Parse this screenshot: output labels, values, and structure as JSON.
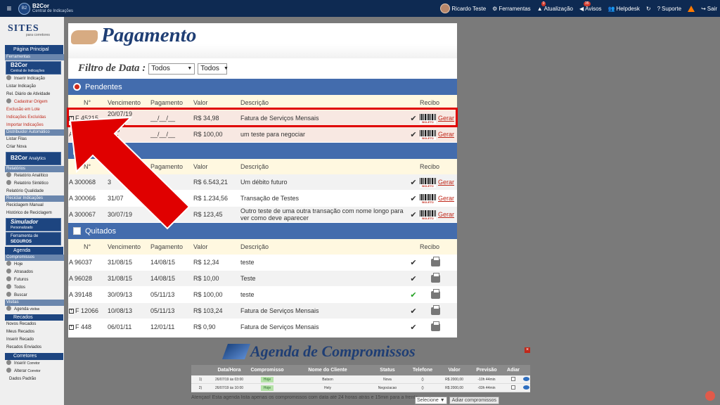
{
  "topbar": {
    "logo_title": "B2Cor",
    "logo_subtitle": "Central de Indicações",
    "user": "Ricardo Teste",
    "items": [
      {
        "label": "Ferramentas"
      },
      {
        "label": "Atualização",
        "badge": "0"
      },
      {
        "label": "Avisos",
        "badge": "35"
      },
      {
        "label": "Helpdesk"
      },
      {
        "label": "Suporte"
      },
      {
        "label": "Sair"
      }
    ]
  },
  "sidebar": {
    "logo": "SITES",
    "logo_sub": "para corretores",
    "pagina_principal": "Página Principal",
    "ferramentas": "Ferramentas",
    "b2cor_title": "B2Cor",
    "b2cor_sub": "Central de Indicações",
    "group1": [
      "Inserir Indicação",
      "Listar Indicação",
      "Rel. Diário de Atividade"
    ],
    "group1_red": [
      "Cadastrar Origem",
      "Exclusão em Lote",
      "Indicações Excluídas",
      "Importar Indicações"
    ],
    "distribuidor": "Distribuidor Automático",
    "distribuidor_items": [
      "Listar Filas",
      "Criar Nova"
    ],
    "analytics_title": "B2Cor",
    "analytics_sub": "Analytics",
    "relatorios": "Relatórios",
    "relatorios_items": [
      "Relatório Analítico",
      "Relatório Sintético",
      "Relatório Qualidade"
    ],
    "reciclar": "Reciclar Indicações",
    "reciclar_items": [
      "Reciclagem Manual",
      "Histórico de Reciclagem"
    ],
    "simulador": "Simulador",
    "simulador_sub": "Personalizado",
    "seguros_a": "Ferramenta de",
    "seguros_b": "SEGUROS",
    "agenda": "Agenda",
    "compromissos": "Compromissos",
    "agenda_items": [
      "Hoje",
      "Atrasados",
      "Futuros",
      "Todos",
      "Buscar"
    ],
    "visitas": "Visitas",
    "visitas_item": "Agenda",
    "visitas_item_suffix": "visitas",
    "recados": "Recados",
    "recados_items": [
      "Novos Recados",
      "Meus Recados",
      "Inserir Recado",
      "Recados Enviados"
    ],
    "corretores": "Corretores",
    "corretores_items": [
      "Inserir",
      "Alterar",
      "Dados Padrão"
    ],
    "corretores_suffix": "Corretor"
  },
  "pagamento": {
    "title": "Pagamento",
    "filtro_label": "Filtro de Data :",
    "filtro1": "Todos",
    "filtro2": "Todos",
    "columns": [
      "N°",
      "Vencimento",
      "Pagamento",
      "Valor",
      "Descrição",
      "Recibo"
    ],
    "sections": [
      {
        "title": "Pendentes",
        "show_header": true,
        "rows": [
          {
            "n": "F 45215",
            "plus": true,
            "venc": "20/07/19",
            "vencido": "vencido",
            "pag": "__/__/__",
            "valor": "R$ 34,98",
            "desc": "Fatura de Serviços Mensais",
            "recibo": "gerar",
            "style": "pink"
          },
          {
            "n": "A",
            "plus": false,
            "venc": "5/19",
            "vencido": "cido",
            "pag": "__/__/__",
            "valor": "R$ 100,00",
            "desc": "um teste para negociar",
            "recibo": "gerar",
            "style": "pink"
          }
        ]
      },
      {
        "title": "",
        "show_header": true,
        "rows": [
          {
            "n": "A 300068",
            "plus": false,
            "venc": "3",
            "vencido": "",
            "pag": "",
            "valor": "R$ 6.543,21",
            "desc": "Um débito futuro",
            "recibo": "gerar",
            "style": "alt"
          },
          {
            "n": "A 300066",
            "plus": false,
            "venc": "31/07",
            "vencido": "",
            "pag": "",
            "valor": "R$ 1.234,56",
            "desc": "Transação de Testes",
            "recibo": "gerar",
            "style": ""
          },
          {
            "n": "A 300067",
            "plus": false,
            "venc": "30/07/19",
            "vencido": "",
            "pag": "",
            "valor": "R$ 123,45",
            "desc": "Outro teste de uma outra transação com nome longo para ver como deve aparecer",
            "recibo": "gerar",
            "style": "alt"
          }
        ]
      },
      {
        "title": "Quitados",
        "show_header": true,
        "rows": [
          {
            "n": "A 96037",
            "plus": false,
            "venc": "31/08/15",
            "vencido": "",
            "pag": "14/08/15",
            "valor": "R$ 12,34",
            "desc": "teste",
            "recibo": "print",
            "style": "",
            "green": false
          },
          {
            "n": "A 96028",
            "plus": false,
            "venc": "31/08/15",
            "vencido": "",
            "pag": "14/08/15",
            "valor": "R$ 10,00",
            "desc": "Teste",
            "recibo": "print",
            "style": "alt",
            "green": false
          },
          {
            "n": "A 39148",
            "plus": false,
            "venc": "30/09/13",
            "vencido": "",
            "pag": "05/11/13",
            "valor": "R$ 100,00",
            "desc": "teste",
            "recibo": "print",
            "style": "",
            "green": true
          },
          {
            "n": "F 12066",
            "plus": true,
            "venc": "10/08/13",
            "vencido": "",
            "pag": "05/11/13",
            "valor": "R$ 103,24",
            "desc": "Fatura de Serviços Mensais",
            "recibo": "print",
            "style": "alt",
            "green": false
          },
          {
            "n": "F 448",
            "plus": true,
            "venc": "06/01/11",
            "vencido": "",
            "pag": "12/01/11",
            "valor": "R$ 0,90",
            "desc": "Fatura de Serviços Mensais",
            "recibo": "print",
            "style": "",
            "green": false
          }
        ]
      }
    ],
    "gerar_label": "Gerar"
  },
  "agenda": {
    "title": "Agenda de Compromissos",
    "columns": [
      "",
      "Data/Hora",
      "Compromisso",
      "Nome do Cliente",
      "Status",
      "Telefone",
      "Valor",
      "Previsão",
      "Adiar",
      ""
    ],
    "rows": [
      {
        "idx": "1)",
        "datahora": "26/07/19 às 03:00",
        "comp": "Hoje",
        "cliente": "Batson",
        "status": "Nova",
        "tel": "()",
        "valor": "R$ 2000,00",
        "prev": "-10h 44min"
      },
      {
        "idx": "2)",
        "datahora": "26/07/19 às 10:00",
        "comp": "Hoje",
        "cliente": "Hely",
        "status": "Negociacao",
        "tel": "()",
        "valor": "R$ 2000,00",
        "prev": "-03h 44min"
      }
    ],
    "footer_text": "Atençao! Esta agenda lista apenas os compromissos com data até 24 horas atrás e 15min para a frente.",
    "select_label": "Selecione",
    "adiar_button": "Adiar compromissos"
  },
  "colors": {
    "nav": "#0e2a52",
    "section": "#436cad",
    "highlight": "#e00000"
  }
}
